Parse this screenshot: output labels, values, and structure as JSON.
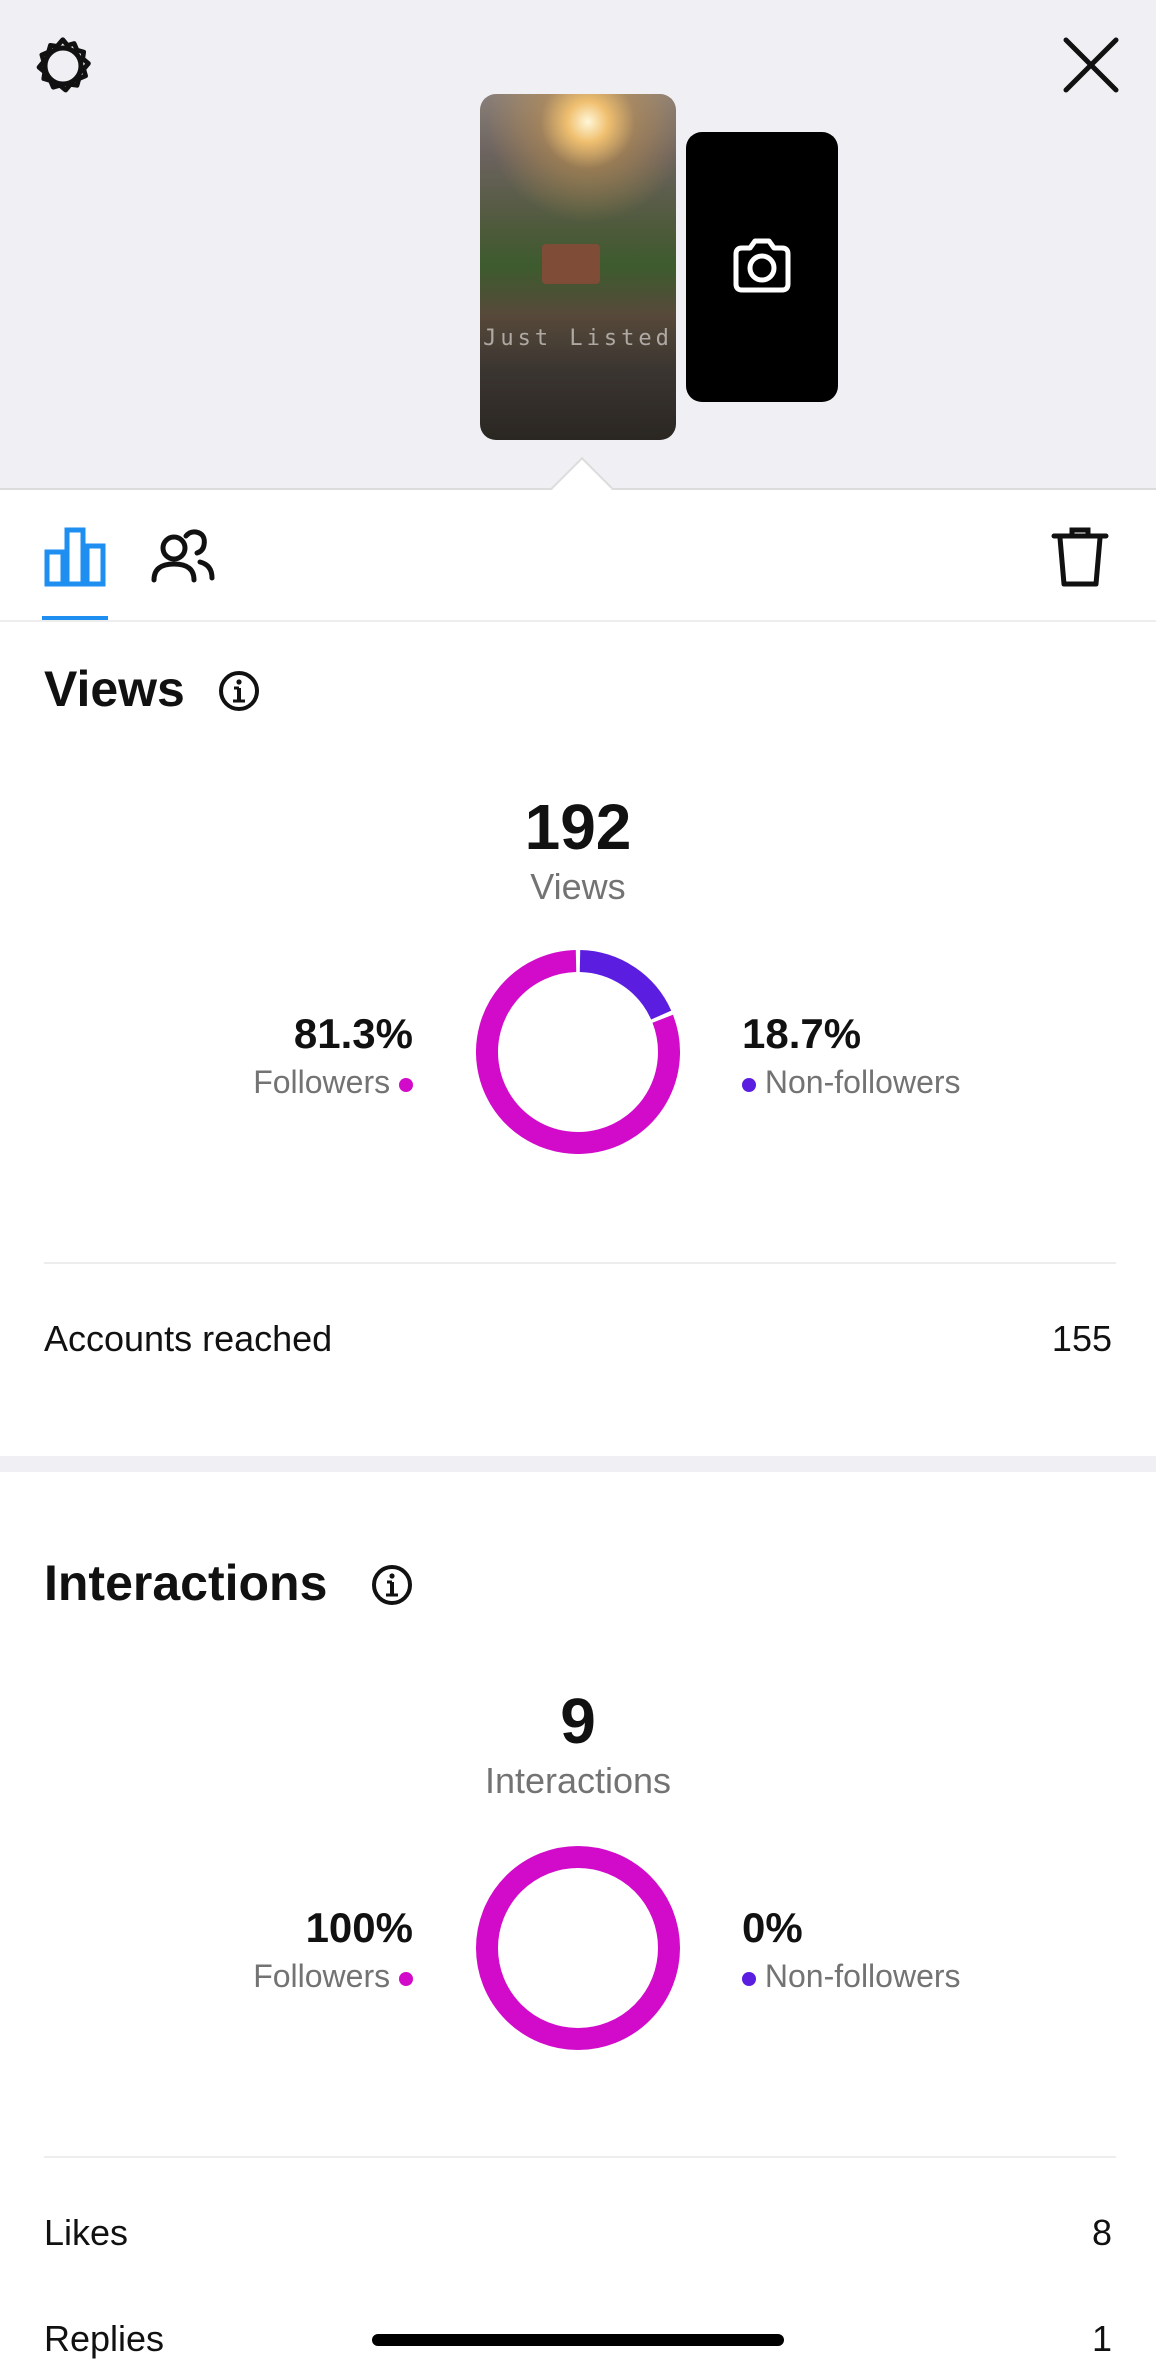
{
  "story_preview": {
    "thumbnail_overlay_text": "Just Listed",
    "icons": [
      "gear-icon",
      "close-icon",
      "camera-icon"
    ]
  },
  "tabs": {
    "icons": [
      "bar-chart-icon",
      "people-icon",
      "trash-icon"
    ],
    "active_tab": "insights",
    "accent_color": "#1f8ef1"
  },
  "views": {
    "title": "Views",
    "total": "192",
    "total_label": "Views",
    "followers_pct": "81.3%",
    "followers_label": "Followers",
    "nonfollowers_pct": "18.7%",
    "nonfollowers_label": "Non-followers",
    "accounts_reached_label": "Accounts reached",
    "accounts_reached_value": "155"
  },
  "interactions": {
    "title": "Interactions",
    "total": "9",
    "total_label": "Interactions",
    "followers_pct": "100%",
    "followers_label": "Followers",
    "nonfollowers_pct": "0%",
    "nonfollowers_label": "Non-followers",
    "rows": [
      {
        "label": "Likes",
        "value": "8"
      },
      {
        "label": "Replies",
        "value": "1"
      }
    ]
  },
  "colors": {
    "followers": "#d10bc9",
    "nonfollowers": "#5b1ee0"
  },
  "chart_data": [
    {
      "type": "pie",
      "categories": [
        "Followers",
        "Non-followers"
      ],
      "values": [
        81.3,
        18.7
      ],
      "title": "Views"
    },
    {
      "type": "pie",
      "categories": [
        "Followers",
        "Non-followers"
      ],
      "values": [
        100,
        0
      ],
      "title": "Interactions"
    }
  ]
}
